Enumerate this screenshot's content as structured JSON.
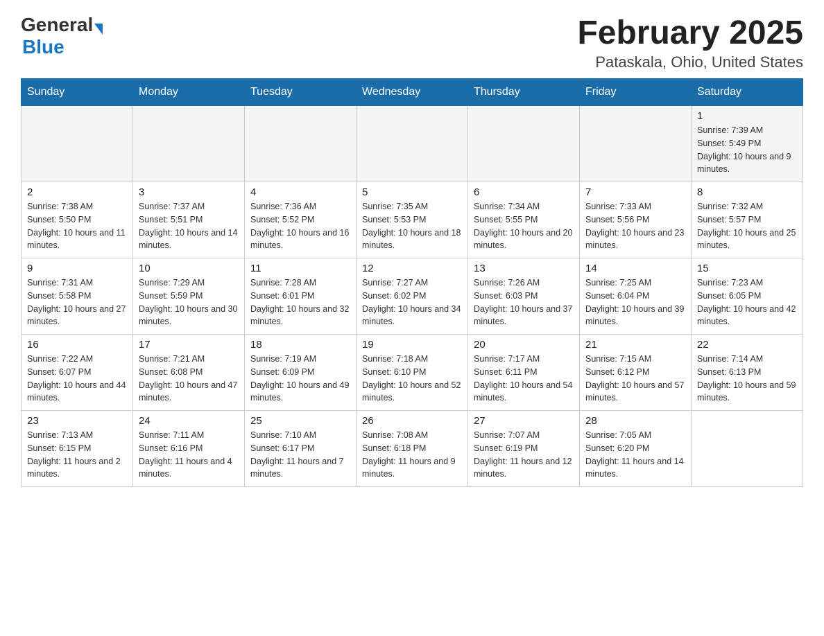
{
  "logo": {
    "general": "General",
    "blue": "Blue"
  },
  "title": {
    "month": "February 2025",
    "location": "Pataskala, Ohio, United States"
  },
  "weekdays": [
    "Sunday",
    "Monday",
    "Tuesday",
    "Wednesday",
    "Thursday",
    "Friday",
    "Saturday"
  ],
  "weeks": [
    [
      {
        "day": "",
        "info": ""
      },
      {
        "day": "",
        "info": ""
      },
      {
        "day": "",
        "info": ""
      },
      {
        "day": "",
        "info": ""
      },
      {
        "day": "",
        "info": ""
      },
      {
        "day": "",
        "info": ""
      },
      {
        "day": "1",
        "info": "Sunrise: 7:39 AM\nSunset: 5:49 PM\nDaylight: 10 hours and 9 minutes."
      }
    ],
    [
      {
        "day": "2",
        "info": "Sunrise: 7:38 AM\nSunset: 5:50 PM\nDaylight: 10 hours and 11 minutes."
      },
      {
        "day": "3",
        "info": "Sunrise: 7:37 AM\nSunset: 5:51 PM\nDaylight: 10 hours and 14 minutes."
      },
      {
        "day": "4",
        "info": "Sunrise: 7:36 AM\nSunset: 5:52 PM\nDaylight: 10 hours and 16 minutes."
      },
      {
        "day": "5",
        "info": "Sunrise: 7:35 AM\nSunset: 5:53 PM\nDaylight: 10 hours and 18 minutes."
      },
      {
        "day": "6",
        "info": "Sunrise: 7:34 AM\nSunset: 5:55 PM\nDaylight: 10 hours and 20 minutes."
      },
      {
        "day": "7",
        "info": "Sunrise: 7:33 AM\nSunset: 5:56 PM\nDaylight: 10 hours and 23 minutes."
      },
      {
        "day": "8",
        "info": "Sunrise: 7:32 AM\nSunset: 5:57 PM\nDaylight: 10 hours and 25 minutes."
      }
    ],
    [
      {
        "day": "9",
        "info": "Sunrise: 7:31 AM\nSunset: 5:58 PM\nDaylight: 10 hours and 27 minutes."
      },
      {
        "day": "10",
        "info": "Sunrise: 7:29 AM\nSunset: 5:59 PM\nDaylight: 10 hours and 30 minutes."
      },
      {
        "day": "11",
        "info": "Sunrise: 7:28 AM\nSunset: 6:01 PM\nDaylight: 10 hours and 32 minutes."
      },
      {
        "day": "12",
        "info": "Sunrise: 7:27 AM\nSunset: 6:02 PM\nDaylight: 10 hours and 34 minutes."
      },
      {
        "day": "13",
        "info": "Sunrise: 7:26 AM\nSunset: 6:03 PM\nDaylight: 10 hours and 37 minutes."
      },
      {
        "day": "14",
        "info": "Sunrise: 7:25 AM\nSunset: 6:04 PM\nDaylight: 10 hours and 39 minutes."
      },
      {
        "day": "15",
        "info": "Sunrise: 7:23 AM\nSunset: 6:05 PM\nDaylight: 10 hours and 42 minutes."
      }
    ],
    [
      {
        "day": "16",
        "info": "Sunrise: 7:22 AM\nSunset: 6:07 PM\nDaylight: 10 hours and 44 minutes."
      },
      {
        "day": "17",
        "info": "Sunrise: 7:21 AM\nSunset: 6:08 PM\nDaylight: 10 hours and 47 minutes."
      },
      {
        "day": "18",
        "info": "Sunrise: 7:19 AM\nSunset: 6:09 PM\nDaylight: 10 hours and 49 minutes."
      },
      {
        "day": "19",
        "info": "Sunrise: 7:18 AM\nSunset: 6:10 PM\nDaylight: 10 hours and 52 minutes."
      },
      {
        "day": "20",
        "info": "Sunrise: 7:17 AM\nSunset: 6:11 PM\nDaylight: 10 hours and 54 minutes."
      },
      {
        "day": "21",
        "info": "Sunrise: 7:15 AM\nSunset: 6:12 PM\nDaylight: 10 hours and 57 minutes."
      },
      {
        "day": "22",
        "info": "Sunrise: 7:14 AM\nSunset: 6:13 PM\nDaylight: 10 hours and 59 minutes."
      }
    ],
    [
      {
        "day": "23",
        "info": "Sunrise: 7:13 AM\nSunset: 6:15 PM\nDaylight: 11 hours and 2 minutes."
      },
      {
        "day": "24",
        "info": "Sunrise: 7:11 AM\nSunset: 6:16 PM\nDaylight: 11 hours and 4 minutes."
      },
      {
        "day": "25",
        "info": "Sunrise: 7:10 AM\nSunset: 6:17 PM\nDaylight: 11 hours and 7 minutes."
      },
      {
        "day": "26",
        "info": "Sunrise: 7:08 AM\nSunset: 6:18 PM\nDaylight: 11 hours and 9 minutes."
      },
      {
        "day": "27",
        "info": "Sunrise: 7:07 AM\nSunset: 6:19 PM\nDaylight: 11 hours and 12 minutes."
      },
      {
        "day": "28",
        "info": "Sunrise: 7:05 AM\nSunset: 6:20 PM\nDaylight: 11 hours and 14 minutes."
      },
      {
        "day": "",
        "info": ""
      }
    ]
  ]
}
